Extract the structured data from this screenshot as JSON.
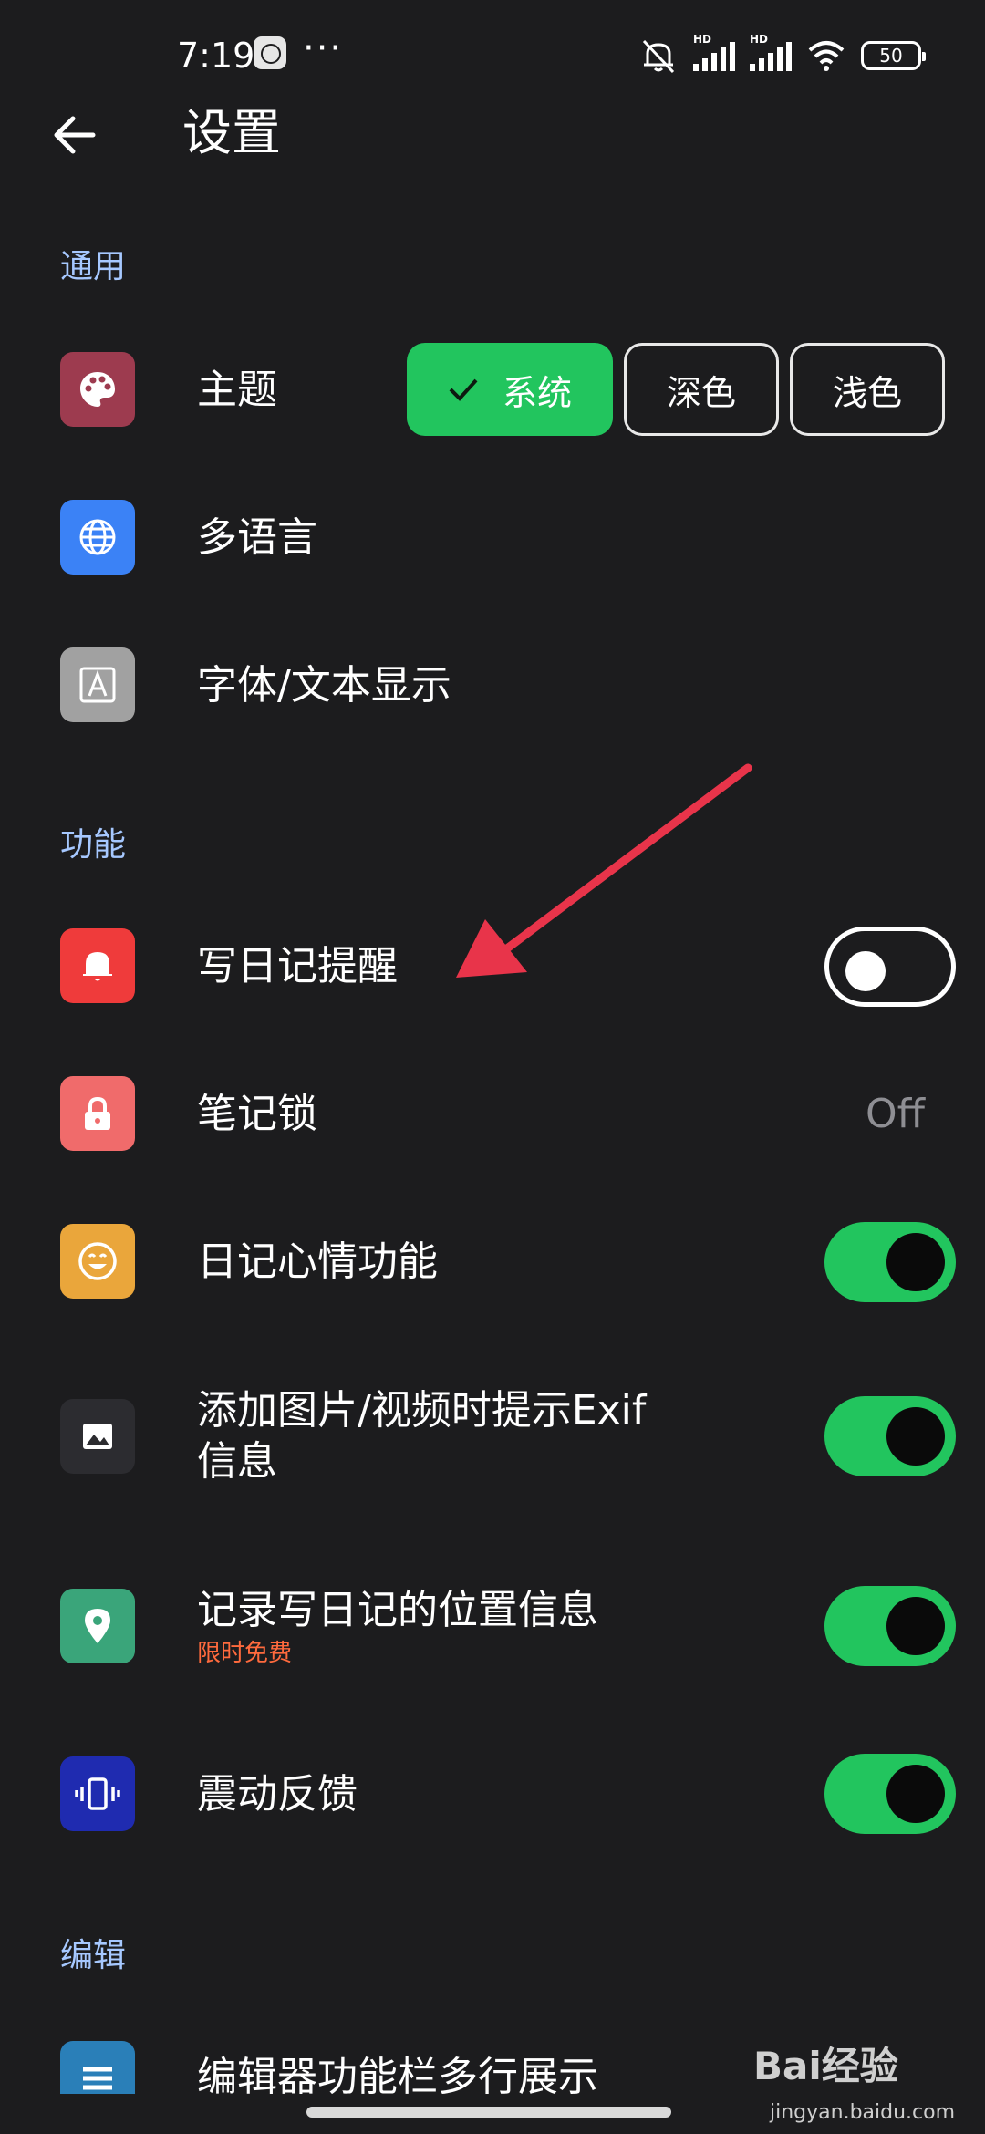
{
  "status_bar": {
    "time": "7:19",
    "more": "···",
    "battery": "50",
    "hd1": "HD",
    "hd2": "HD"
  },
  "app_bar": {
    "title": "设置",
    "back_icon": "arrow-left-icon"
  },
  "sections": {
    "general": "通用",
    "features": "功能",
    "editing": "编辑"
  },
  "theme": {
    "label": "主题",
    "icon": "palette-icon",
    "icon_color": "#9d3b4f",
    "options": [
      "系统",
      "深色",
      "浅色"
    ],
    "selected": "系统"
  },
  "rows": {
    "language": {
      "label": "多语言",
      "icon": "globe-icon",
      "icon_color": "#3b82f6"
    },
    "font": {
      "label": "字体/文本显示",
      "icon": "font-a-icon",
      "icon_color": "#a1a1a1"
    },
    "diary_reminder": {
      "label": "写日记提醒",
      "icon": "bell-icon",
      "icon_color": "#ef3b3b",
      "toggle": "off"
    },
    "note_lock": {
      "label": "笔记锁",
      "icon": "lock-icon",
      "icon_color": "#f06b6b",
      "value": "Off"
    },
    "mood": {
      "label": "日记心情功能",
      "icon": "smile-icon",
      "icon_color": "#eaa63b",
      "toggle": "on"
    },
    "exif": {
      "label_line1": "添加图片/视频时提示Exif",
      "label_line2": "信息",
      "icon": "image-icon",
      "icon_color": "#2c2c30",
      "toggle": "on"
    },
    "location": {
      "label": "记录写日记的位置信息",
      "badge": "限时免费",
      "icon": "location-pin-icon",
      "icon_color": "#3aa57a",
      "toggle": "on"
    },
    "haptic": {
      "label": "震动反馈",
      "icon": "vibration-icon",
      "icon_color": "#1f2bb0",
      "toggle": "on"
    },
    "toolbar": {
      "label": "编辑器功能栏多行展示",
      "icon": "menu-lines-icon",
      "icon_color": "#2a7fb8"
    }
  },
  "annotation": {
    "arrow_color": "#e8344a"
  },
  "watermark": {
    "text": "Bai经验",
    "sub": "jingyan.baidu.com"
  }
}
